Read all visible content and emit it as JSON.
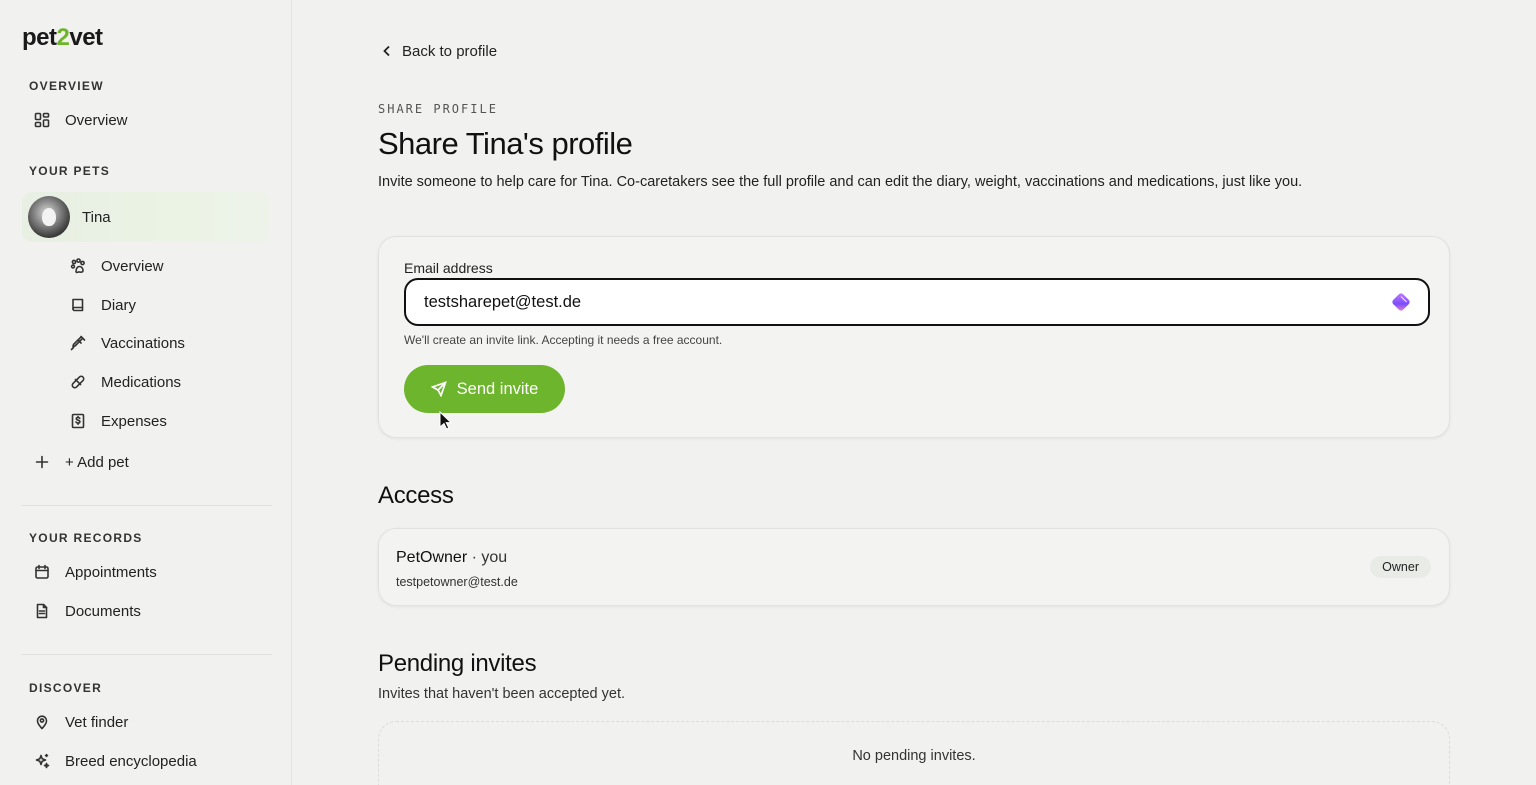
{
  "brand": {
    "logo_prefix": "pet",
    "logo_two": "2",
    "logo_suffix": "vet"
  },
  "sidebar": {
    "overview_section": "OVERVIEW",
    "overview_item": "Overview",
    "pets_section": "YOUR PETS",
    "pet_name": "Tina",
    "pet_items": [
      "Overview",
      "Diary",
      "Vaccinations",
      "Medications",
      "Expenses"
    ],
    "add_pet": "+ Add pet",
    "records_section": "YOUR RECORDS",
    "records_items": [
      "Appointments",
      "Documents"
    ],
    "discover_section": "DISCOVER",
    "discover_items": [
      "Vet finder",
      "Breed encyclopedia"
    ]
  },
  "main": {
    "back_label": "Back to profile",
    "eyebrow": "SHARE PROFILE",
    "title": "Share Tina's profile",
    "subtitle": "Invite someone to help care for Tina. Co-caretakers see the full profile and can edit the diary, weight, vaccinations and medications, just like you.",
    "form": {
      "email_label": "Email address",
      "email_value": "testsharepet@test.de",
      "hint": "We'll create an invite link. Accepting it needs a free account.",
      "send_label": "Send invite"
    },
    "access": {
      "heading": "Access",
      "member_name": "PetOwner",
      "member_suffix": " · you",
      "member_email": "testpetowner@test.de",
      "role": "Owner"
    },
    "pending": {
      "heading": "Pending invites",
      "subtitle": "Invites that haven't been accepted yet.",
      "empty": "No pending invites."
    }
  },
  "colors": {
    "accent": "#6db52d",
    "background": "#f1f1ef"
  }
}
